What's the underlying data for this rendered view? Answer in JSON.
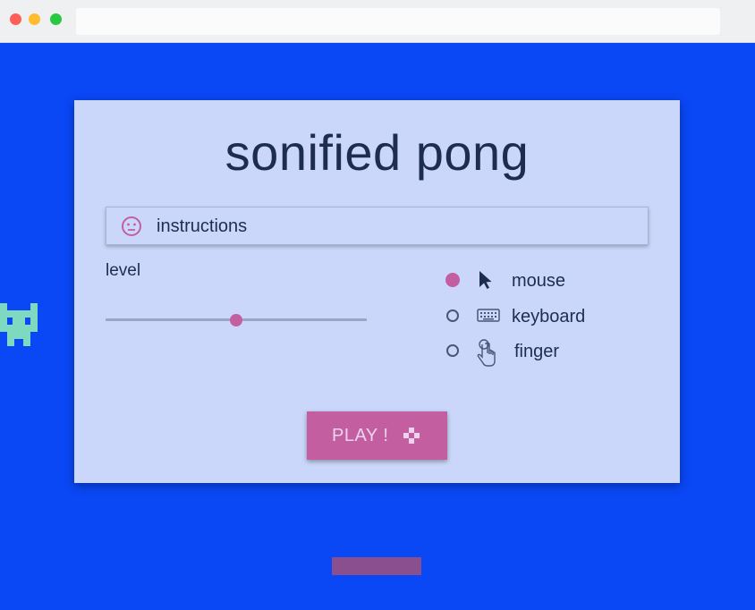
{
  "browser": {
    "address": ""
  },
  "dialog": {
    "title": "sonified pong",
    "instructions_label": "instructions",
    "instructions_icon": "neutral-face-icon",
    "level_label": "level",
    "level_value": 0.5
  },
  "input_options": [
    {
      "label": "mouse",
      "icon": "cursor-arrow-icon",
      "selected": true
    },
    {
      "label": "keyboard",
      "icon": "keyboard-icon",
      "selected": false
    },
    {
      "label": "finger",
      "icon": "hand-pointer-icon",
      "selected": false
    }
  ],
  "play_button": {
    "label": "PLAY !",
    "icon": "gamepad-icon"
  },
  "colors": {
    "background": "#0a47f5",
    "dialog": "#cbd7fa",
    "accent": "#c35fa0",
    "text": "#1d2d4f",
    "paddle": "#8a4f8e",
    "invader": "#7fd8c0"
  }
}
